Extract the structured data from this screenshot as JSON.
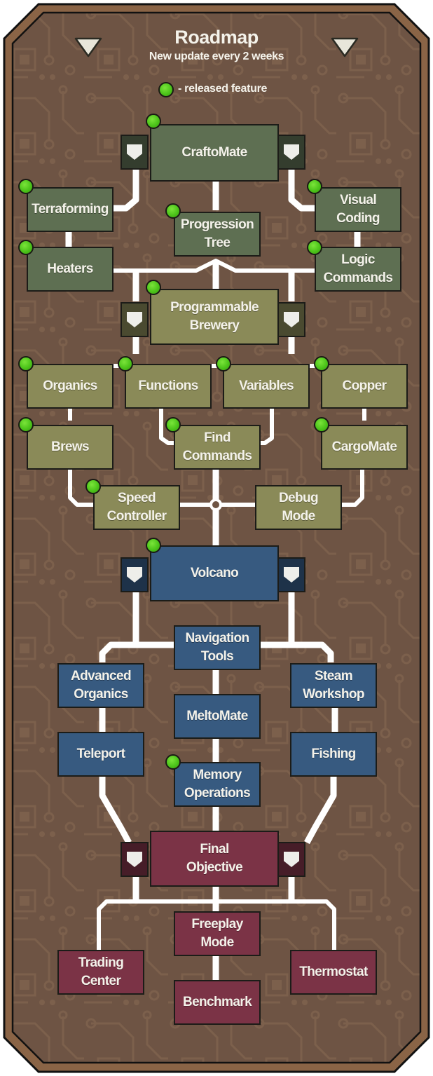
{
  "header": {
    "title": "Roadmap",
    "subtitle": "New update every 2 weeks",
    "legend_label": "- released feature"
  },
  "colors": {
    "frame_border": "#8a6446",
    "background": "#6e5444",
    "line": "#ffffff",
    "released_dot": "#4cc41a",
    "tier_green": "#5e6f52",
    "tier_olive": "#8a8a58",
    "tier_blue": "#375a80",
    "tier_red": "#7b3346"
  },
  "tiers": [
    {
      "name": "CraftoMate tier",
      "color": "green",
      "milestone": {
        "label": "CraftoMate",
        "released": true
      },
      "features": [
        {
          "label": "Terraforming",
          "released": true
        },
        {
          "label": "Heaters",
          "released": true
        },
        {
          "label": "Progression\nTree",
          "released": true
        },
        {
          "label": "Visual\nCoding",
          "released": true
        },
        {
          "label": "Logic\nCommands",
          "released": true
        }
      ]
    },
    {
      "name": "Programmable Brewery tier",
      "color": "olive",
      "milestone": {
        "label": "Programmable\nBrewery",
        "released": true
      },
      "features": [
        {
          "label": "Organics",
          "released": true
        },
        {
          "label": "Functions",
          "released": true
        },
        {
          "label": "Variables",
          "released": true
        },
        {
          "label": "Copper",
          "released": true
        },
        {
          "label": "Brews",
          "released": true
        },
        {
          "label": "Find\nCommands",
          "released": true
        },
        {
          "label": "CargoMate",
          "released": true
        },
        {
          "label": "Speed\nController",
          "released": true
        },
        {
          "label": "Debug\nMode",
          "released": false
        }
      ]
    },
    {
      "name": "Volcano tier",
      "color": "blue",
      "milestone": {
        "label": "Volcano",
        "released": true
      },
      "features": [
        {
          "label": "Navigation\nTools",
          "released": false
        },
        {
          "label": "Advanced\nOrganics",
          "released": false
        },
        {
          "label": "Steam\nWorkshop",
          "released": false
        },
        {
          "label": "MeltoMate",
          "released": false
        },
        {
          "label": "Teleport",
          "released": false
        },
        {
          "label": "Fishing",
          "released": false
        },
        {
          "label": "Memory\nOperations",
          "released": true
        }
      ]
    },
    {
      "name": "Final Objective tier",
      "color": "red",
      "milestone": {
        "label": "Final\nObjective",
        "released": false
      },
      "features": [
        {
          "label": "Freeplay\nMode",
          "released": false
        },
        {
          "label": "Trading\nCenter",
          "released": false
        },
        {
          "label": "Thermostat",
          "released": false
        },
        {
          "label": "Benchmark",
          "released": false
        }
      ]
    }
  ]
}
